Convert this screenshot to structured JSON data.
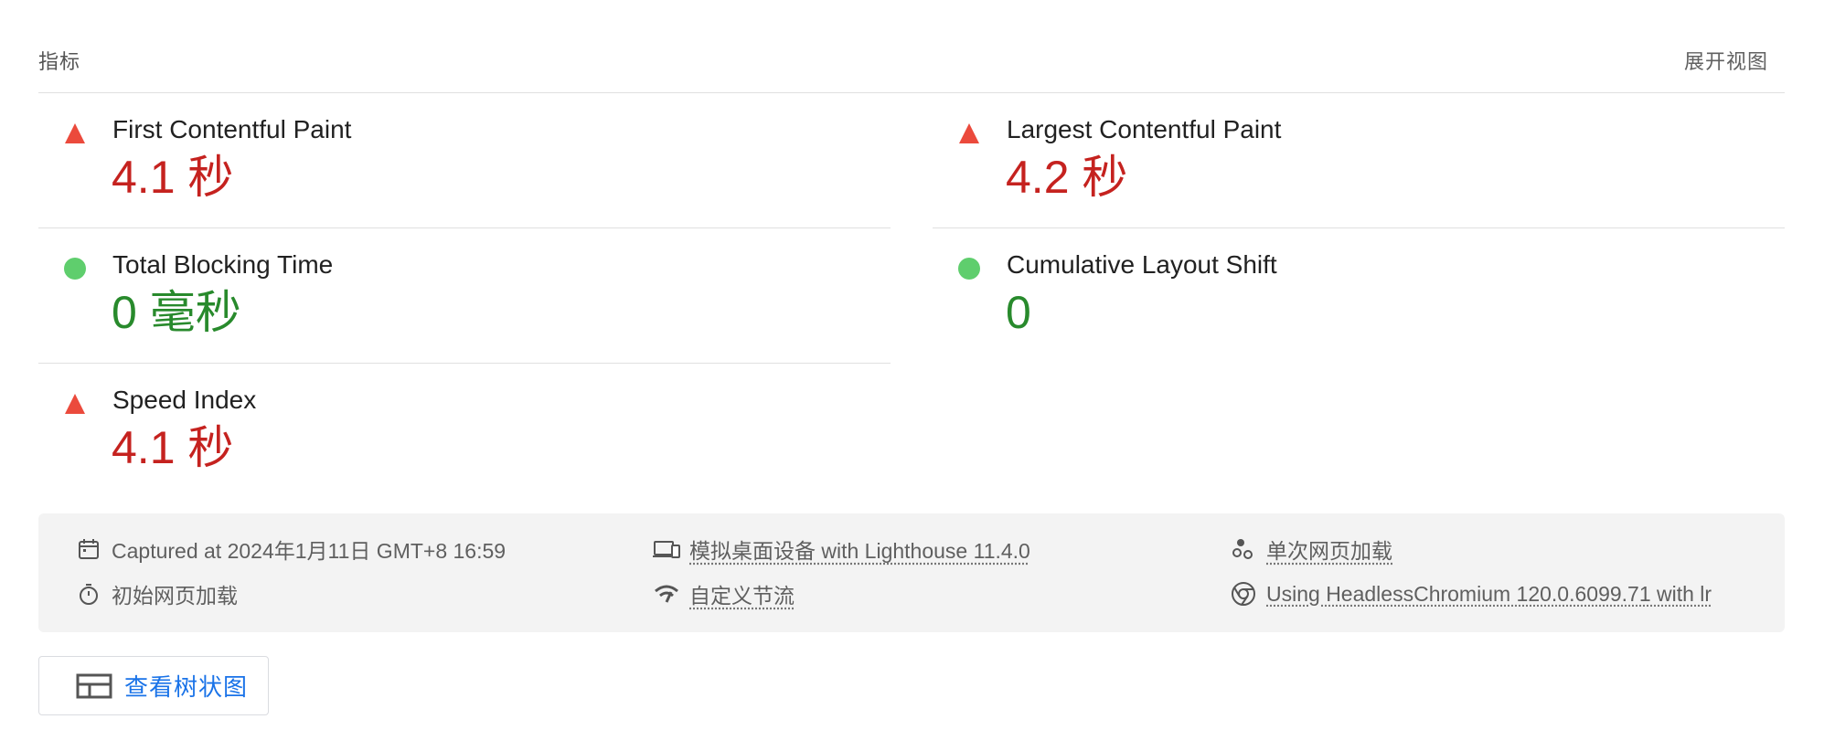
{
  "header": {
    "title": "指标",
    "expand_label": "展开视图"
  },
  "metrics": [
    {
      "name": "First Contentful Paint",
      "value": "4.1 秒",
      "status": "fail",
      "indicator": "red-triangle-icon"
    },
    {
      "name": "Largest Contentful Paint",
      "value": "4.2 秒",
      "status": "fail",
      "indicator": "red-triangle-icon"
    },
    {
      "name": "Total Blocking Time",
      "value": "0 毫秒",
      "status": "pass",
      "indicator": "green-circle-icon"
    },
    {
      "name": "Cumulative Layout Shift",
      "value": "0",
      "status": "pass",
      "indicator": "green-circle-icon"
    },
    {
      "name": "Speed Index",
      "value": "4.1 秒",
      "status": "fail",
      "indicator": "red-triangle-icon"
    }
  ],
  "info": {
    "captured": "Captured at 2024年1月11日 GMT+8 16:59",
    "initial_load": "初始网页加载",
    "device": "模拟桌面设备 with Lighthouse 11.4.0",
    "throttling": "自定义节流",
    "single_load": "单次网页加载",
    "browser": "Using HeadlessChromium 120.0.6099.71 with lr"
  },
  "tree_button": {
    "label": "查看树状图"
  },
  "colors": {
    "fail": "#c5221f",
    "fail_icon": "#eb4a3c",
    "pass": "#288a2c",
    "pass_icon": "#5fce6d",
    "link": "#1a73e8",
    "panel_bg": "#f3f3f3"
  }
}
